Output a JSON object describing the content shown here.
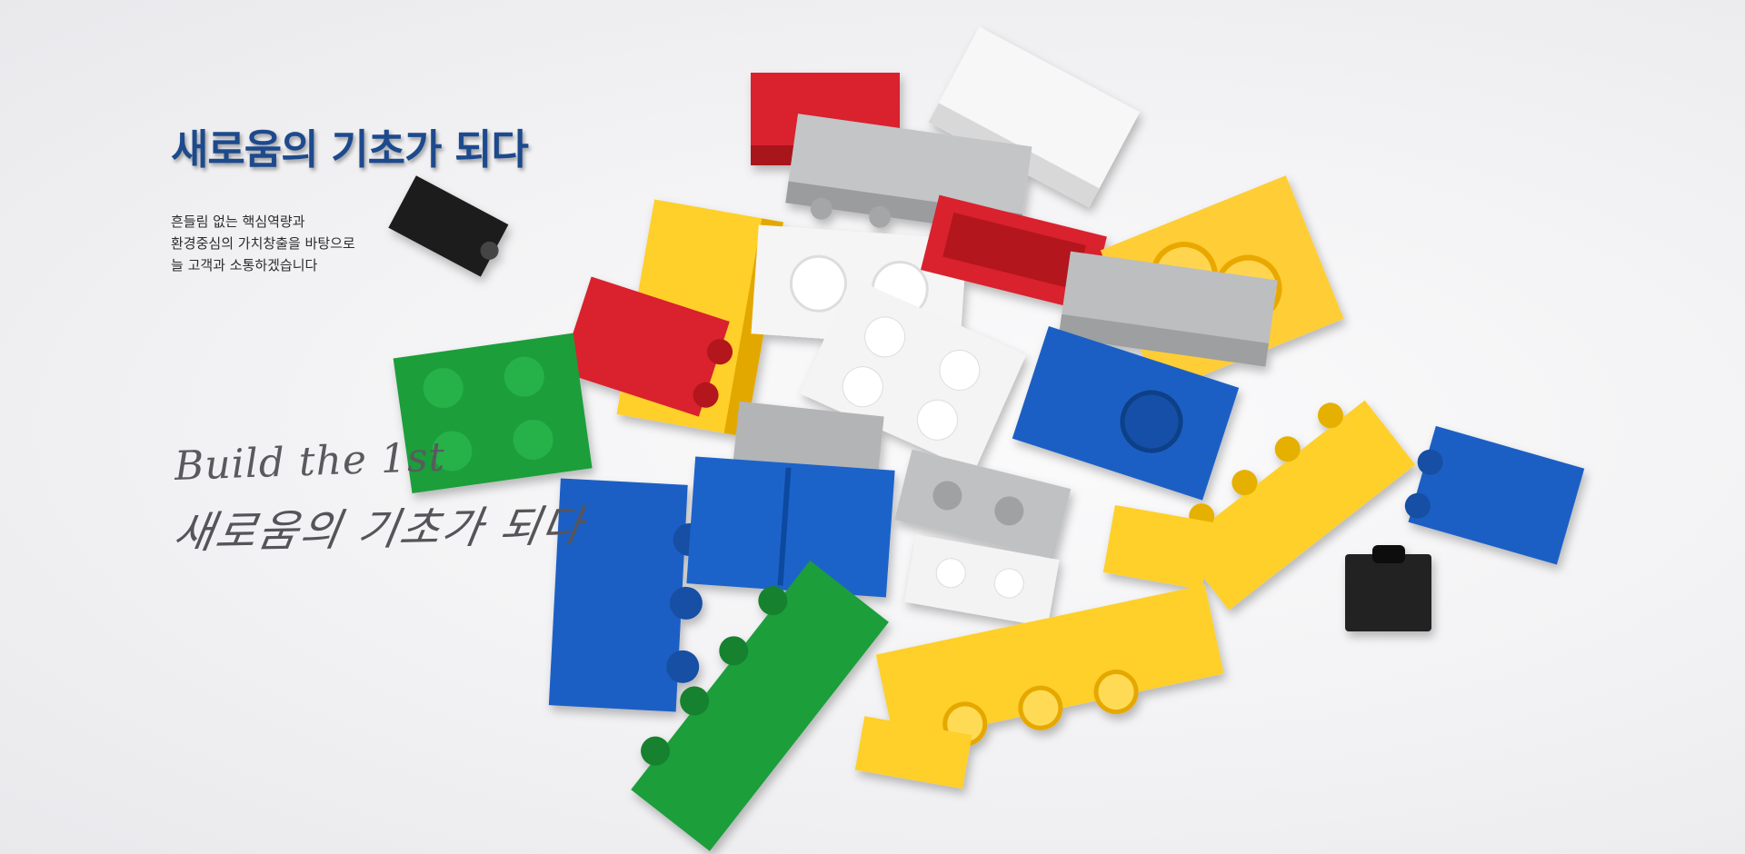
{
  "hero": {
    "headline": "새로움의 기초가 되다",
    "sub_lines": [
      "흔들림 없는 핵심역량과",
      "환경중심의 가치창출을 바탕으로",
      "늘 고객과 소통하겠습니다"
    ]
  },
  "script": {
    "english": "Build the 1st",
    "korean": "새로움의 기초가 되다"
  },
  "colors": {
    "headline": "#1d4a8c",
    "brick_red": "#d9242f",
    "brick_yellow": "#ffcf2b",
    "brick_blue": "#1a5fc4",
    "brick_green": "#1f9e3b",
    "brick_gray": "#b9bbbd",
    "brick_white": "#f7f7f7",
    "brick_black": "#222222"
  }
}
